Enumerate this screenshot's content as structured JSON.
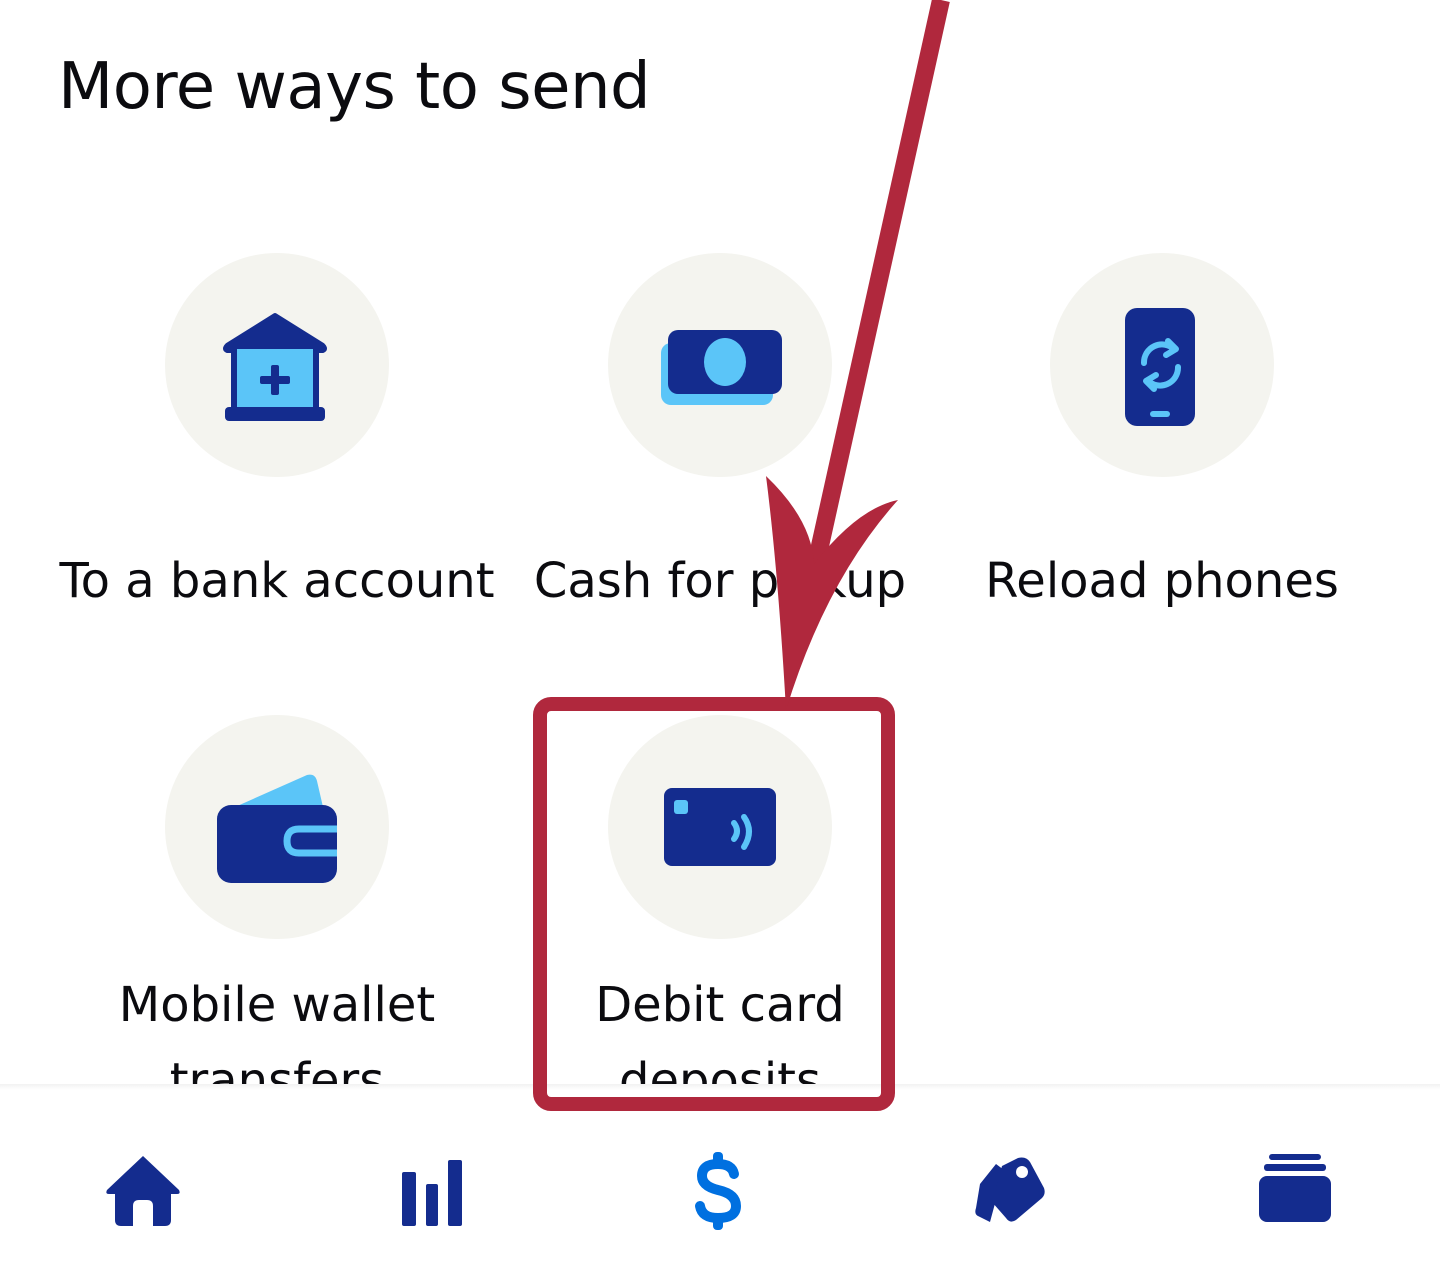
{
  "header": {
    "title": "More ways to send"
  },
  "options": [
    {
      "label": "To a bank account",
      "icon": "bank-icon"
    },
    {
      "label": "Cash for pickup",
      "icon": "cash-icon"
    },
    {
      "label": "Reload phones",
      "icon": "phone-reload-icon"
    },
    {
      "label": "Mobile wallet transfers",
      "icon": "wallet-icon"
    },
    {
      "label": "Debit card deposits",
      "icon": "debit-card-icon"
    }
  ],
  "tabbar": {
    "items": [
      {
        "icon": "home-icon"
      },
      {
        "icon": "bar-chart-icon"
      },
      {
        "icon": "dollar-icon"
      },
      {
        "icon": "tags-icon"
      },
      {
        "icon": "cards-icon"
      }
    ]
  },
  "colors": {
    "primary": "#142c8e",
    "accent": "#5bc5f8",
    "circle_bg": "#f4f4ef",
    "annotation": "#b0283d",
    "send_tab": "#0070e0"
  }
}
